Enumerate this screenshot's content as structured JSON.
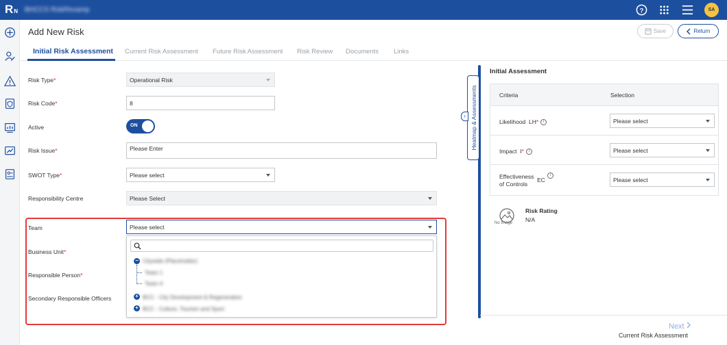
{
  "topbar": {
    "logo": "R",
    "logo_suffix": "N",
    "org_name": "BHCCS RiskRevamp",
    "icons": [
      "help-icon",
      "apps-grid-icon",
      "menu-icon"
    ],
    "user_initials": "SA"
  },
  "rail_icons": [
    "add-icon",
    "user-edit-icon",
    "warning-icon",
    "shield-doc-icon",
    "report-chart-icon",
    "trend-chart-icon",
    "contact-card-icon"
  ],
  "header": {
    "title": "Add New Risk",
    "save_label": "Save",
    "return_label": "Return"
  },
  "tabs": [
    {
      "label": "Initial Risk Assessment",
      "active": true
    },
    {
      "label": "Current Risk Assessment",
      "active": false
    },
    {
      "label": "Future Risk Assessment",
      "active": false
    },
    {
      "label": "Risk Review",
      "active": false
    },
    {
      "label": "Documents",
      "active": false
    },
    {
      "label": "Links",
      "active": false
    }
  ],
  "form": {
    "risk_type": {
      "label": "Risk Type",
      "value": "Operational Risk"
    },
    "risk_code": {
      "label": "Risk Code",
      "value": "8"
    },
    "active": {
      "label": "Active",
      "value": "ON"
    },
    "risk_issue": {
      "label": "Risk Issue",
      "placeholder": "Please Enter"
    },
    "swot_type": {
      "label": "SWOT Type",
      "value": "Please select"
    },
    "responsibility_centre": {
      "label": "Responsibility Centre",
      "value": "Please Select"
    },
    "team": {
      "label": "Team",
      "value": "Please select"
    },
    "business_unit": {
      "label": "Business Unit"
    },
    "responsible_person": {
      "label": "Responsible Person"
    },
    "secondary_officers": {
      "label": "Secondary Responsible Officers"
    }
  },
  "team_dropdown": {
    "items": [
      {
        "label": "Citywide (Placeholder)",
        "level": 0,
        "expanded": true
      },
      {
        "label": "Team 1",
        "level": 1
      },
      {
        "label": "Team 4",
        "level": 1
      },
      {
        "label": "BCC - City Development & Regeneration",
        "level": 0,
        "expanded": false
      },
      {
        "label": "BCC - Culture, Tourism and Sport",
        "level": 0,
        "expanded": false
      }
    ]
  },
  "side_panel": {
    "toggle_label": "Heatmap & Assessments",
    "title": "Initial Assessment",
    "col_criteria": "Criteria",
    "col_selection": "Selection",
    "rows": [
      {
        "criteria": "Likelihood",
        "code": "LH",
        "value": "Please select"
      },
      {
        "criteria": "Impact",
        "code": "I",
        "value": "Please select"
      },
      {
        "criteria_line1": "Effectiveness",
        "criteria_line2": "of Controls",
        "code": "EC",
        "value": "Please select"
      }
    ],
    "no_image_label": "No Image",
    "risk_rating_label": "Risk Rating",
    "risk_rating_value": "N/A"
  },
  "footer": {
    "next_label": "Next",
    "next_sub": "Current Risk Assessment"
  },
  "colors": {
    "brand": "#1d4f9f",
    "highlight": "#e03a3a",
    "avatar": "#f5c342"
  }
}
